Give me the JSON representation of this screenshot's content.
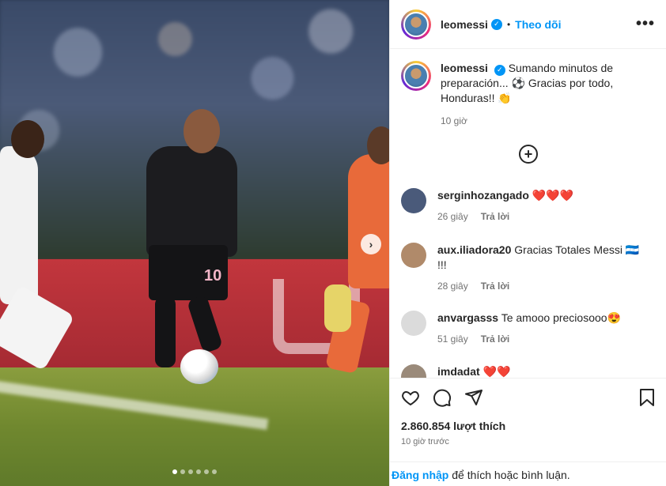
{
  "header": {
    "username": "leomessi",
    "separator": "•",
    "follow_label": "Theo dõi",
    "more_label": "•••"
  },
  "caption": {
    "username": "leomessi",
    "text": "Sumando minutos de preparación... ⚽ Gracias por todo, Honduras!! 👏",
    "time": "10 giờ"
  },
  "load_more_label": "+",
  "comments": [
    {
      "username": "serginhozangado",
      "text": "❤️❤️❤️",
      "time": "26 giây",
      "reply": "Trả lời",
      "avatar_color": "#4a5a7a"
    },
    {
      "username": "aux.iliadora20",
      "text": "Gracias Totales Messi 🇭🇳 !!!",
      "time": "28 giây",
      "reply": "Trả lời",
      "avatar_color": "#b08a6a"
    },
    {
      "username": "anvargasss",
      "text": "Te amooo preciosooo😍",
      "time": "51 giây",
      "reply": "Trả lời",
      "avatar_color": "#dbdbdb"
    },
    {
      "username": "imdadat",
      "text": "❤️❤️",
      "time": "",
      "reply": "",
      "avatar_color": "#9a8a7a"
    }
  ],
  "actions": {
    "likes": "2.860.854 lượt thích",
    "ago": "10 giờ trước"
  },
  "login": {
    "link": "Đăng nhập",
    "rest": " để thích hoặc bình luận."
  },
  "photo": {
    "jersey_number": "10",
    "carousel_next": "›",
    "carousel_count": 6,
    "carousel_active": 1
  },
  "colors": {
    "accent": "#0095f6",
    "heart": "#e0163a",
    "muted": "#737373"
  }
}
